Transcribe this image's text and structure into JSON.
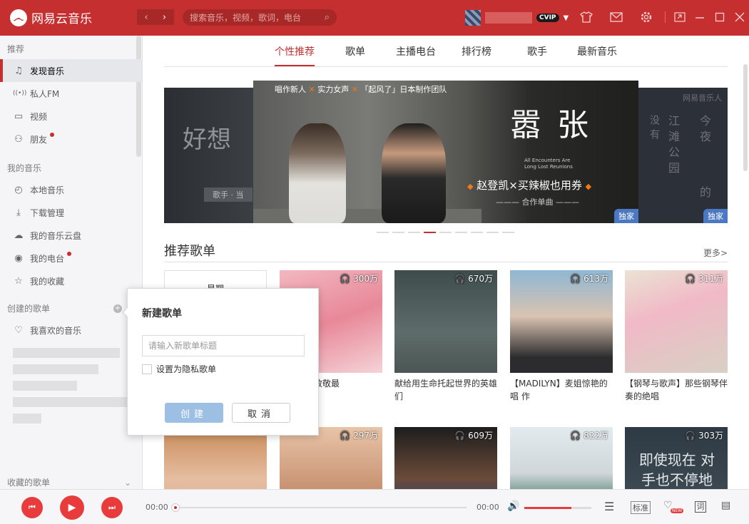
{
  "app": {
    "logo_glyph": "෴",
    "title": "网易云音乐"
  },
  "titlebar": {
    "back": "‹",
    "forward": "›",
    "search_placeholder": "搜索音乐，视频，歌词，电台",
    "vip": "CVIP",
    "icons": [
      "skin-icon",
      "mail-icon",
      "settings-icon"
    ],
    "window": [
      "mini-mode-icon",
      "minimize-icon",
      "maximize-icon",
      "close-icon"
    ]
  },
  "sidebar": {
    "recommend": "推荐",
    "items": [
      {
        "label": "发现音乐",
        "icon": "♫"
      },
      {
        "label": "私人FM",
        "icon": "((•))"
      },
      {
        "label": "视频",
        "icon": "▭"
      },
      {
        "label": "朋友",
        "icon": "⚇"
      }
    ],
    "my_music": "我的音乐",
    "my_items": [
      {
        "label": "本地音乐",
        "icon": "◴"
      },
      {
        "label": "下载管理",
        "icon": "⤓"
      },
      {
        "label": "我的音乐云盘",
        "icon": "☁"
      },
      {
        "label": "我的电台",
        "icon": "◉"
      },
      {
        "label": "我的收藏",
        "icon": "☆"
      }
    ],
    "created": "创建的歌单",
    "liked": "我喜欢的音乐",
    "collected": "收藏的歌单"
  },
  "tabs": [
    "个性推荐",
    "歌单",
    "主播电台",
    "排行榜",
    "歌手",
    "最新音乐"
  ],
  "banner": {
    "header_parts": [
      "唱作新人",
      "实力女声",
      "「起风了」日本制作团队"
    ],
    "calligraphy": "嚣张",
    "subtitle": "All Encounters Are Long Lost Reunions",
    "promo": "赵登凯×买辣椒也用券",
    "coop": "合作单曲",
    "exclusive": "独家",
    "left_tag": "歌手 · 当",
    "right_brand": "网易音乐人",
    "right_text": [
      "今夜",
      "江滩公园",
      "的"
    ]
  },
  "section": {
    "title": "推荐歌单",
    "more": "更多>"
  },
  "playlists": [
    {
      "title": "星期",
      "plays": ""
    },
    {
      "title": "：用音乐致敬最",
      "plays": "300万"
    },
    {
      "title": "献给用生命托起世界的英雄们",
      "plays": "670万"
    },
    {
      "title": "【MADILYN】麦姐惊艳的唱 作",
      "plays": "613万"
    },
    {
      "title": "【钢琴与歌声】那些钢琴伴奏的绝唱",
      "plays": "311万"
    },
    {
      "title": "",
      "plays": ""
    },
    {
      "title": "",
      "plays": "297万"
    },
    {
      "title": "",
      "plays": "609万"
    },
    {
      "title": "",
      "plays": "822万"
    },
    {
      "title": "",
      "plays": "303万"
    }
  ],
  "row2_overlay_text": "即使现在 对手也不停地",
  "dialog": {
    "title": "新建歌单",
    "placeholder": "请输入新歌单标题",
    "private_label": "设置为隐私歌单",
    "create": "创建",
    "cancel": "取消"
  },
  "player": {
    "current_time": "00:00",
    "total_time": "00:00",
    "progress": 0,
    "volume": 0.7,
    "quality": "标准",
    "lyrics": "词"
  }
}
